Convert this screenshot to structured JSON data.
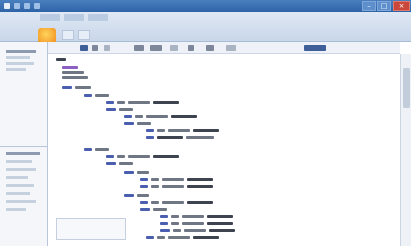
{
  "window": {
    "title": "",
    "buttons": {
      "minimize": "–",
      "maximize": "□",
      "close": "×"
    }
  },
  "toolbar": {
    "items": [
      "",
      "",
      "",
      "",
      "",
      "",
      "",
      "",
      "",
      ""
    ]
  },
  "code": {
    "lines": [
      "",
      "",
      "",
      "",
      "",
      "",
      "",
      "",
      "",
      "",
      "",
      "",
      "",
      "",
      "",
      "",
      "",
      "",
      "",
      "",
      "",
      "",
      "",
      "",
      ""
    ]
  },
  "colors": {
    "titlebar": "#2f63a8",
    "ribbon": "#c9d7ea",
    "orb": "#f08a1c",
    "keyword": "#4a5fb0",
    "highlight": "#8c5fc2"
  },
  "icons": [
    "app-icon",
    "office-orb-icon",
    "minimize-icon",
    "maximize-icon",
    "close-icon"
  ]
}
